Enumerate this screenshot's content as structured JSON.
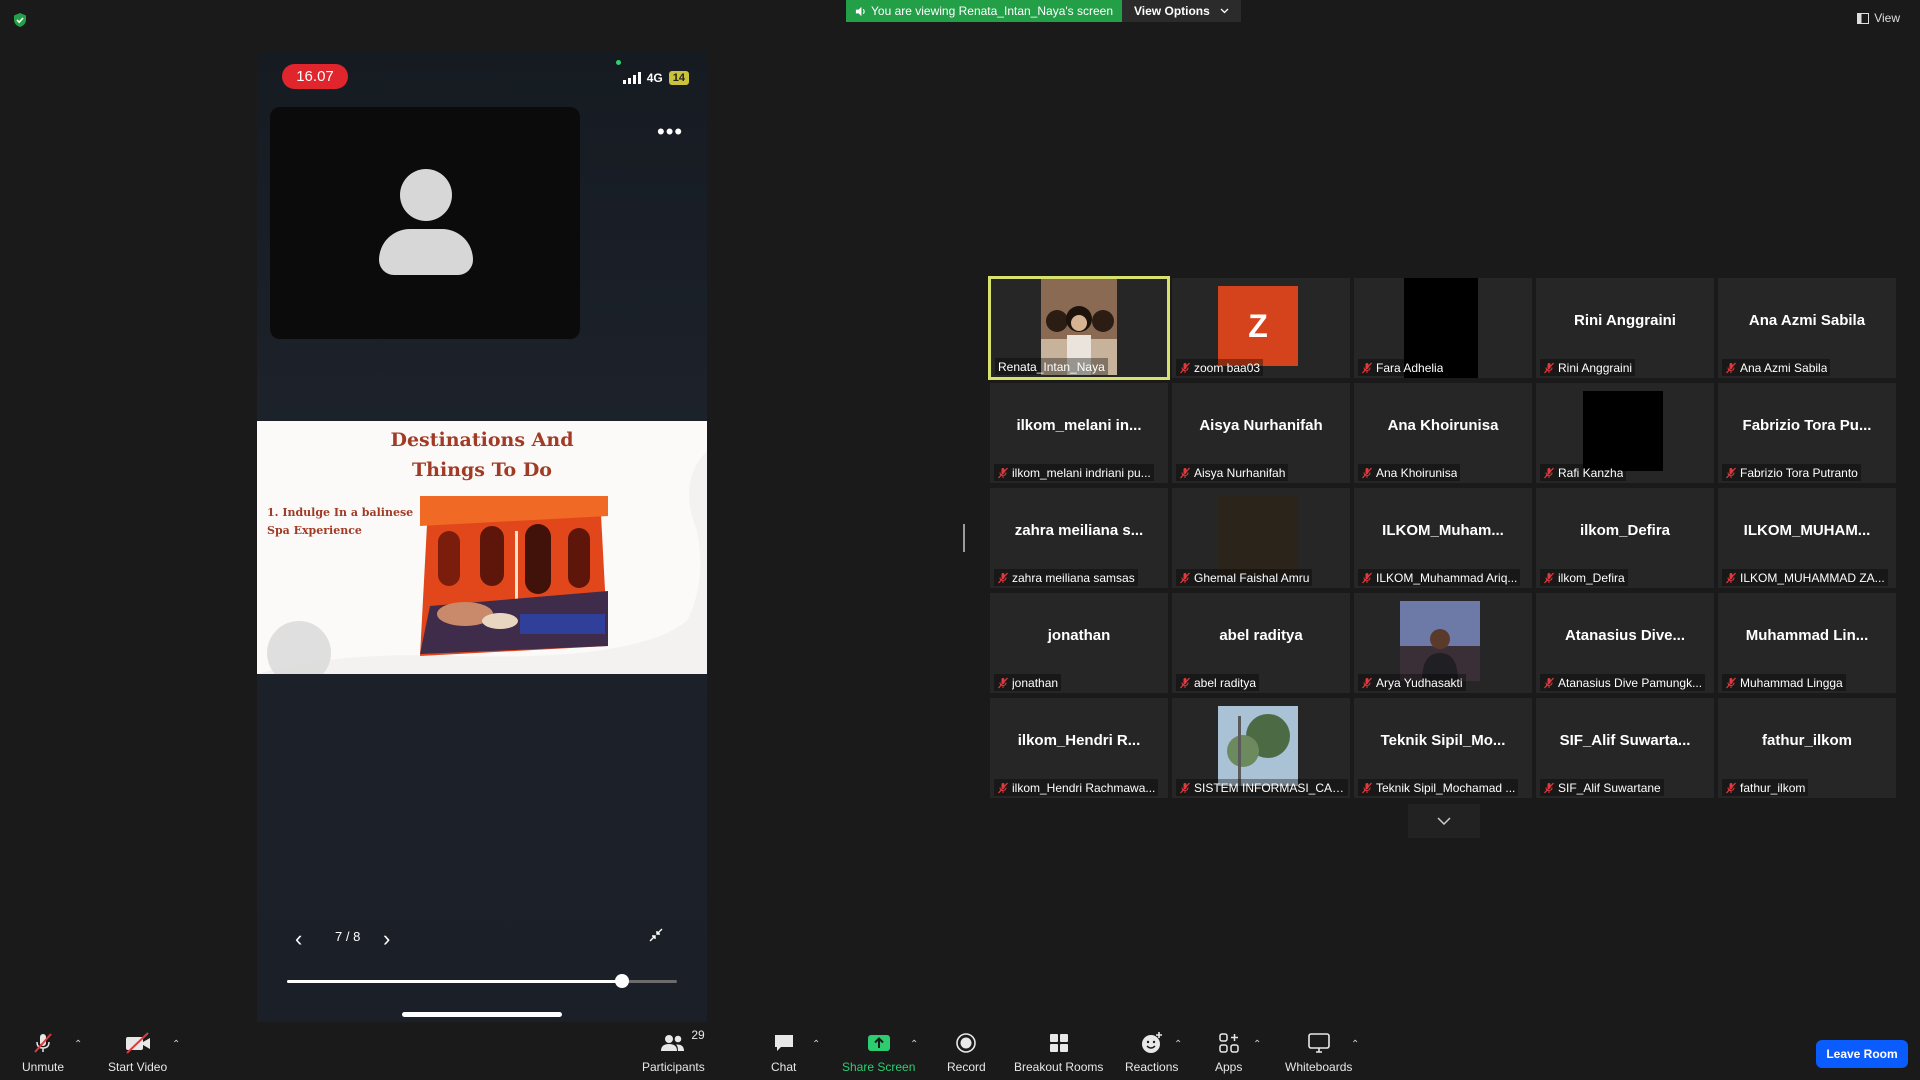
{
  "banner": {
    "message": "You are viewing Renata_Intan_Naya's screen",
    "options_label": "View Options"
  },
  "view_label": "View",
  "phone": {
    "time": "16.07",
    "network": "4G",
    "battery": "14",
    "slide": {
      "title": "Destinations And Things To Do",
      "item": "1. Indulge In a balinese Spa Experience"
    },
    "page_indicator": "7 / 8",
    "progress_fraction": 0.86
  },
  "gallery": [
    {
      "name": "",
      "label": "Renata_Intan_Naya",
      "media": "photo-group",
      "active": true,
      "muted": false
    },
    {
      "name": "",
      "label": "zoom baa03",
      "media": "avatar-z",
      "avatar_letter": "Z",
      "avatar_color": "#d5431c",
      "muted": true
    },
    {
      "name": "",
      "label": "Fara Adhelia",
      "media": "black",
      "muted": true
    },
    {
      "name": "Rini Anggraini",
      "label": "Rini Anggraini",
      "muted": true
    },
    {
      "name": "Ana Azmi Sabila",
      "label": "Ana Azmi Sabila",
      "muted": true
    },
    {
      "name": "ilkom_melani  in...",
      "label": "ilkom_melani indriani pu...",
      "muted": true
    },
    {
      "name": "Aisya Nurhanifah",
      "label": "Aisya Nurhanifah",
      "muted": true
    },
    {
      "name": "Ana Khoirunisa",
      "label": "Ana Khoirunisa",
      "muted": true
    },
    {
      "name": "",
      "label": "Rafi Kanzha",
      "media": "black",
      "muted": true
    },
    {
      "name": "Fabrizio Tora Pu...",
      "label": "Fabrizio Tora Putranto",
      "muted": true
    },
    {
      "name": "zahra  meiliana  s...",
      "label": "zahra meiliana samsas",
      "muted": true
    },
    {
      "name": "",
      "label": "Ghemal Faishal Amru",
      "media": "dark-photo",
      "muted": true
    },
    {
      "name": "ILKOM_Muham...",
      "label": "ILKOM_Muhammad Ariq...",
      "muted": true
    },
    {
      "name": "ilkom_Defira",
      "label": "ilkom_Defira",
      "muted": true
    },
    {
      "name": "ILKOM_MUHAM...",
      "label": "ILKOM_MUHAMMAD ZA...",
      "muted": true
    },
    {
      "name": "jonathan",
      "label": "jonathan",
      "muted": true
    },
    {
      "name": "abel raditya",
      "label": "abel raditya",
      "muted": true
    },
    {
      "name": "",
      "label": "Arya Yudhasakti",
      "media": "photo-person",
      "muted": true
    },
    {
      "name": "Atanasius  Dive...",
      "label": "Atanasius Dive Pamungk...",
      "muted": true
    },
    {
      "name": "Muhammad  Lin...",
      "label": "Muhammad Lingga",
      "muted": true
    },
    {
      "name": "ilkom_Hendri  R...",
      "label": "ilkom_Hendri Rachmawa...",
      "muted": true
    },
    {
      "name": "",
      "label": "SISTEM INFORMASI_CAS...",
      "media": "photo-tree",
      "muted": true
    },
    {
      "name": "Teknik  Sipil_Mo...",
      "label": "Teknik Sipil_Mochamad ...",
      "muted": true
    },
    {
      "name": "SIF_Alif  Suwarta...",
      "label": "SIF_Alif Suwartane",
      "muted": true
    },
    {
      "name": "fathur_ilkom",
      "label": "fathur_ilkom",
      "muted": true
    }
  ],
  "toolbar": {
    "unmute": "Unmute",
    "start_video": "Start Video",
    "participants": "Participants",
    "participants_count": "29",
    "chat": "Chat",
    "share_screen": "Share Screen",
    "record": "Record",
    "breakout_rooms": "Breakout Rooms",
    "reactions": "Reactions",
    "apps": "Apps",
    "whiteboards": "Whiteboards",
    "leave": "Leave Room"
  },
  "colors": {
    "accent_blue": "#0b5cff",
    "share_green": "#2ecc71",
    "banner_green": "#23a047",
    "active_speaker": "#d6e26a",
    "muted_red": "#e0393e"
  }
}
